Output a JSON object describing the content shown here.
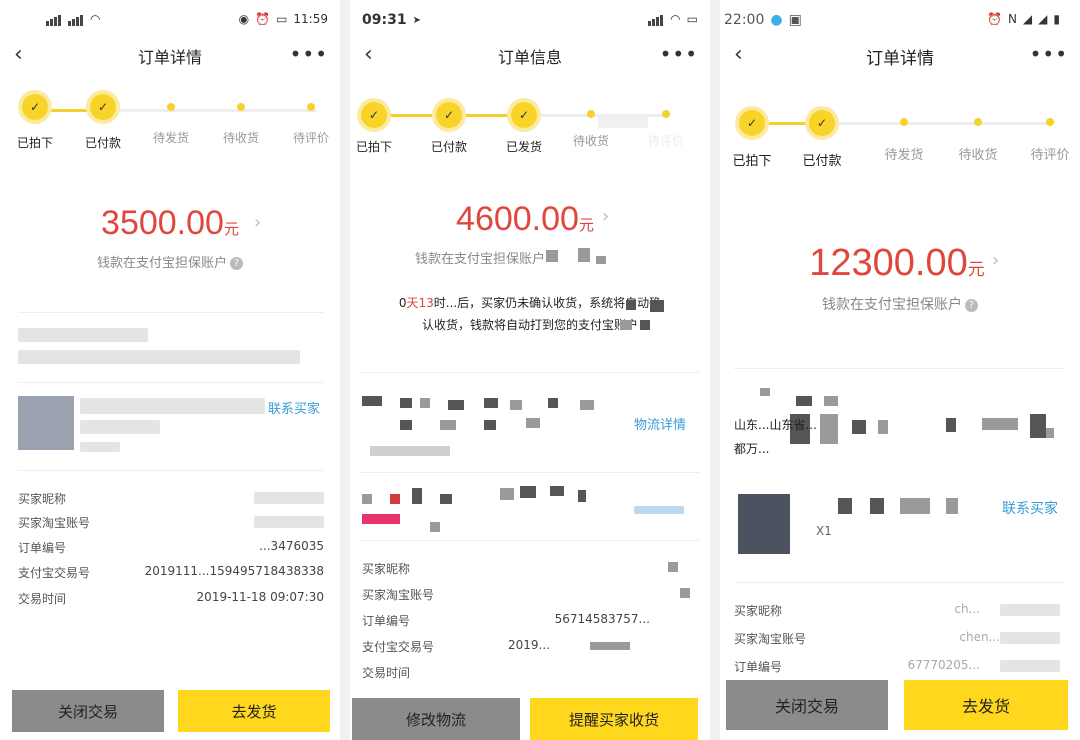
{
  "panels": [
    {
      "status": {
        "time": "11:59"
      },
      "header": {
        "title": "订单详情"
      },
      "steps": [
        "已拍下",
        "已付款",
        "待发货",
        "待收货",
        "待评价"
      ],
      "amount": {
        "value": "3500.00",
        "unit": "元"
      },
      "escrow_text": "钱款在支付宝担保账户",
      "contact_buyer": "联系买家",
      "info_rows": [
        {
          "label": "买家昵称",
          "value": ""
        },
        {
          "label": "买家淘宝账号",
          "value": ""
        },
        {
          "label": "订单编号",
          "value": "...3476035"
        },
        {
          "label": "支付宝交易号",
          "value": "2019111...159495718438338"
        },
        {
          "label": "交易时间",
          "value": "2019-11-18 09:07:30"
        }
      ],
      "buttons": {
        "left": "关闭交易",
        "right": "去发货"
      }
    },
    {
      "status": {
        "time": "09:31"
      },
      "header": {
        "title": "订单信息"
      },
      "steps": [
        "已拍下",
        "已付款",
        "已发货",
        "待收货",
        "待评价"
      ],
      "amount": {
        "value": "4600.00",
        "unit": "元"
      },
      "escrow_text": "钱款在支付宝担保账户",
      "countdown": {
        "prefix": "0",
        "red_part": "天13",
        "line1": "时...后，买家仍未确认收货，系统将自动确",
        "line2": "认收货，钱款将自动打到您的支付宝账户"
      },
      "logistics_detail": "物流详情",
      "info_rows": [
        {
          "label": "买家昵称",
          "value": ""
        },
        {
          "label": "买家淘宝账号",
          "value": ""
        },
        {
          "label": "订单编号",
          "value": "56714583757..."
        },
        {
          "label": "支付宝交易号",
          "value": "2019..."
        },
        {
          "label": "交易时间",
          "value": ""
        }
      ],
      "buttons": {
        "left": "修改物流",
        "right": "提醒买家收货"
      }
    },
    {
      "status": {
        "time": "22:00"
      },
      "header": {
        "title": "订单详情"
      },
      "steps": [
        "已拍下",
        "已付款",
        "待发货",
        "待收货",
        "待评价"
      ],
      "amount": {
        "value": "12300.00",
        "unit": "元"
      },
      "escrow_text": "钱款在支付宝担保账户",
      "address": {
        "line1": "山东...山东省...",
        "line2": "都万..."
      },
      "product_qty": "X1",
      "contact_buyer": "联系买家",
      "info_rows": [
        {
          "label": "买家昵称",
          "value": "ch..."
        },
        {
          "label": "买家淘宝账号",
          "value": "chen..."
        },
        {
          "label": "订单编号",
          "value": "67770205..."
        }
      ],
      "buttons": {
        "left": "关闭交易",
        "right": "去发货"
      }
    }
  ],
  "icons": {
    "back": "back-arrow-icon",
    "more": "more-dots-icon",
    "check": "check-icon",
    "help": "help-icon"
  },
  "colors": {
    "accent_yellow": "#ffd71c",
    "amount_red": "#e0463c",
    "link_blue": "#3a9cd6",
    "button_gray": "#8b8b8b"
  }
}
